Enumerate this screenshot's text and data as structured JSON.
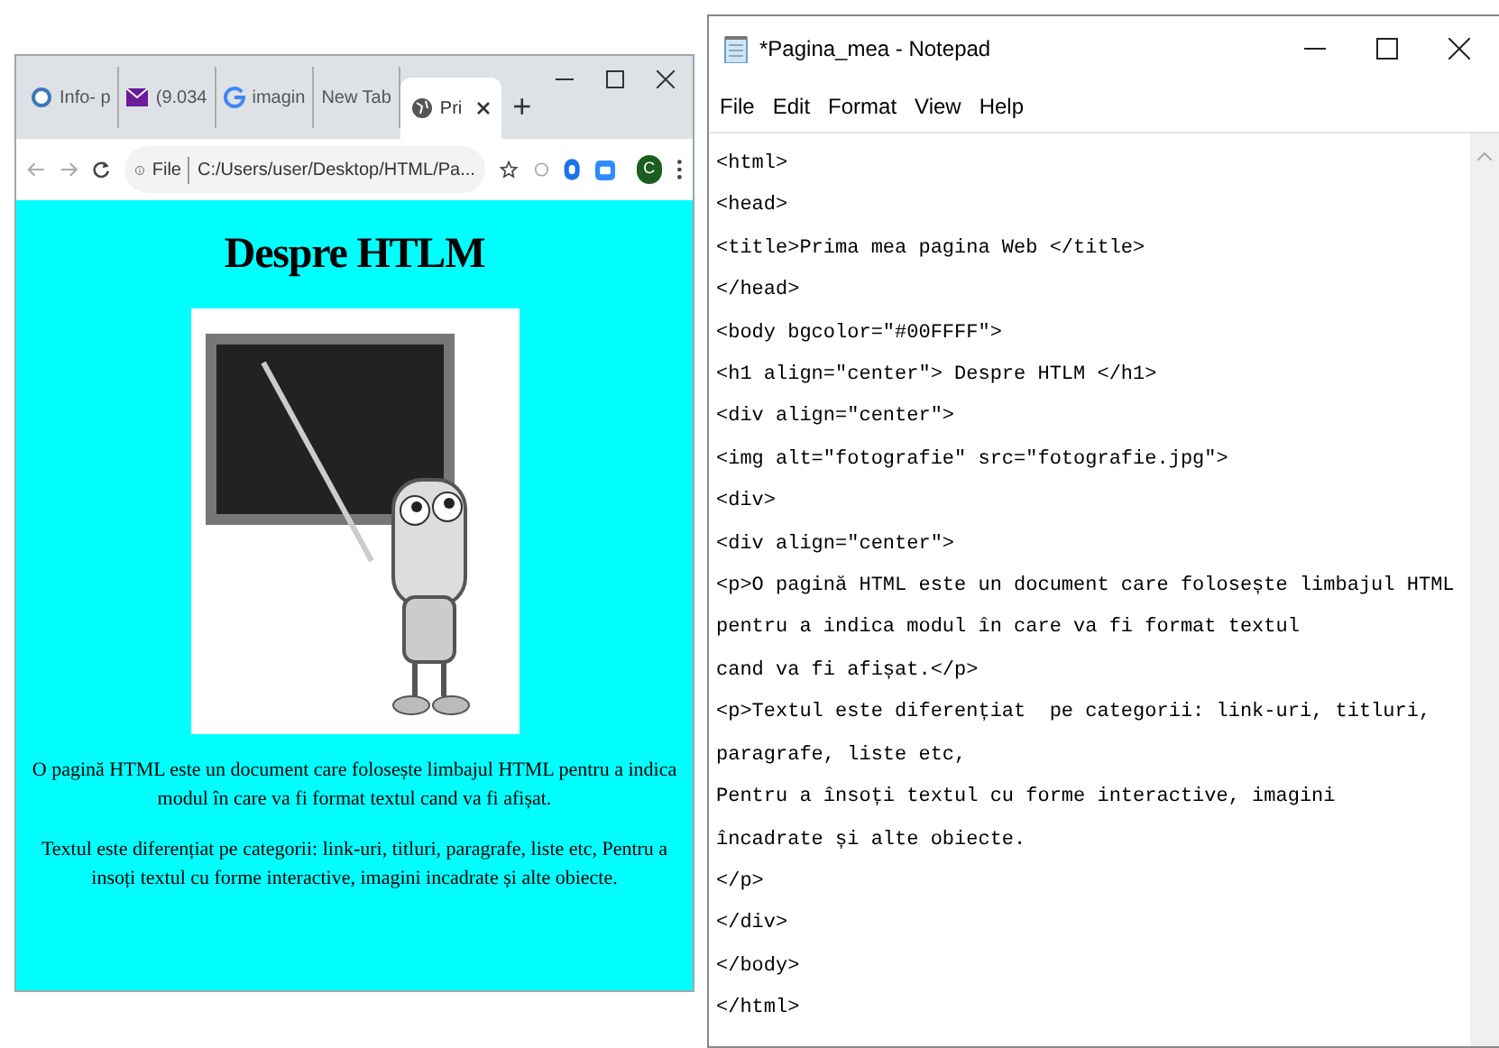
{
  "browser": {
    "tabs": [
      {
        "label": "Info- p",
        "kind": "site",
        "selected": false
      },
      {
        "label": "(9.034",
        "kind": "mail",
        "selected": false
      },
      {
        "label": "imagin",
        "kind": "google",
        "selected": false
      },
      {
        "label": "New Tab",
        "kind": "blank",
        "selected": false
      },
      {
        "label": "Pri",
        "kind": "globe",
        "selected": true
      }
    ],
    "new_tab": "+",
    "address": {
      "scheme": "File",
      "url": "C:/Users/user/Desktop/HTML/Pa..."
    },
    "profile": "C",
    "page": {
      "heading": "Despre HTLM",
      "paragraphs": [
        "O pagină HTML este un document care folosește limbajul HTML pentru a indica modul în care va fi format textul cand va fi afișat.",
        "Textul este diferențiat pe categorii: link-uri, titluri, paragrafe, liste etc, Pentru a insoți textul cu forme interactive, imagini incadrate și alte obiecte."
      ]
    }
  },
  "notepad": {
    "title": "*Pagina_mea - Notepad",
    "menu": [
      {
        "label": "File"
      },
      {
        "label": "Edit"
      },
      {
        "label": "Format"
      },
      {
        "label": "View"
      },
      {
        "label": "Help"
      }
    ],
    "lines": [
      "<html>",
      "<head>",
      "<title>Prima mea pagina Web </title>",
      "</head>",
      "<body bgcolor=\"#00FFFF\">",
      "<h1 align=\"center\"> Despre HTLM </h1>",
      "<div align=\"center\">",
      "<img alt=\"fotografie\" src=\"fotografie.jpg\">",
      "<div>",
      "<div align=\"center\">",
      "<p>O pagină HTML este un document care folosește limbajul HTML",
      "pentru a indica modul în care va fi format textul",
      "cand va fi afișat.</p>",
      "<p>Textul este diferențiat  pe categorii: link-uri, titluri,",
      "paragrafe, liste etc,",
      "Pentru a însoți textul cu forme interactive, imagini",
      "încadrate și alte obiecte.",
      "</p>",
      "</div>",
      "</body>",
      "</html>"
    ]
  }
}
